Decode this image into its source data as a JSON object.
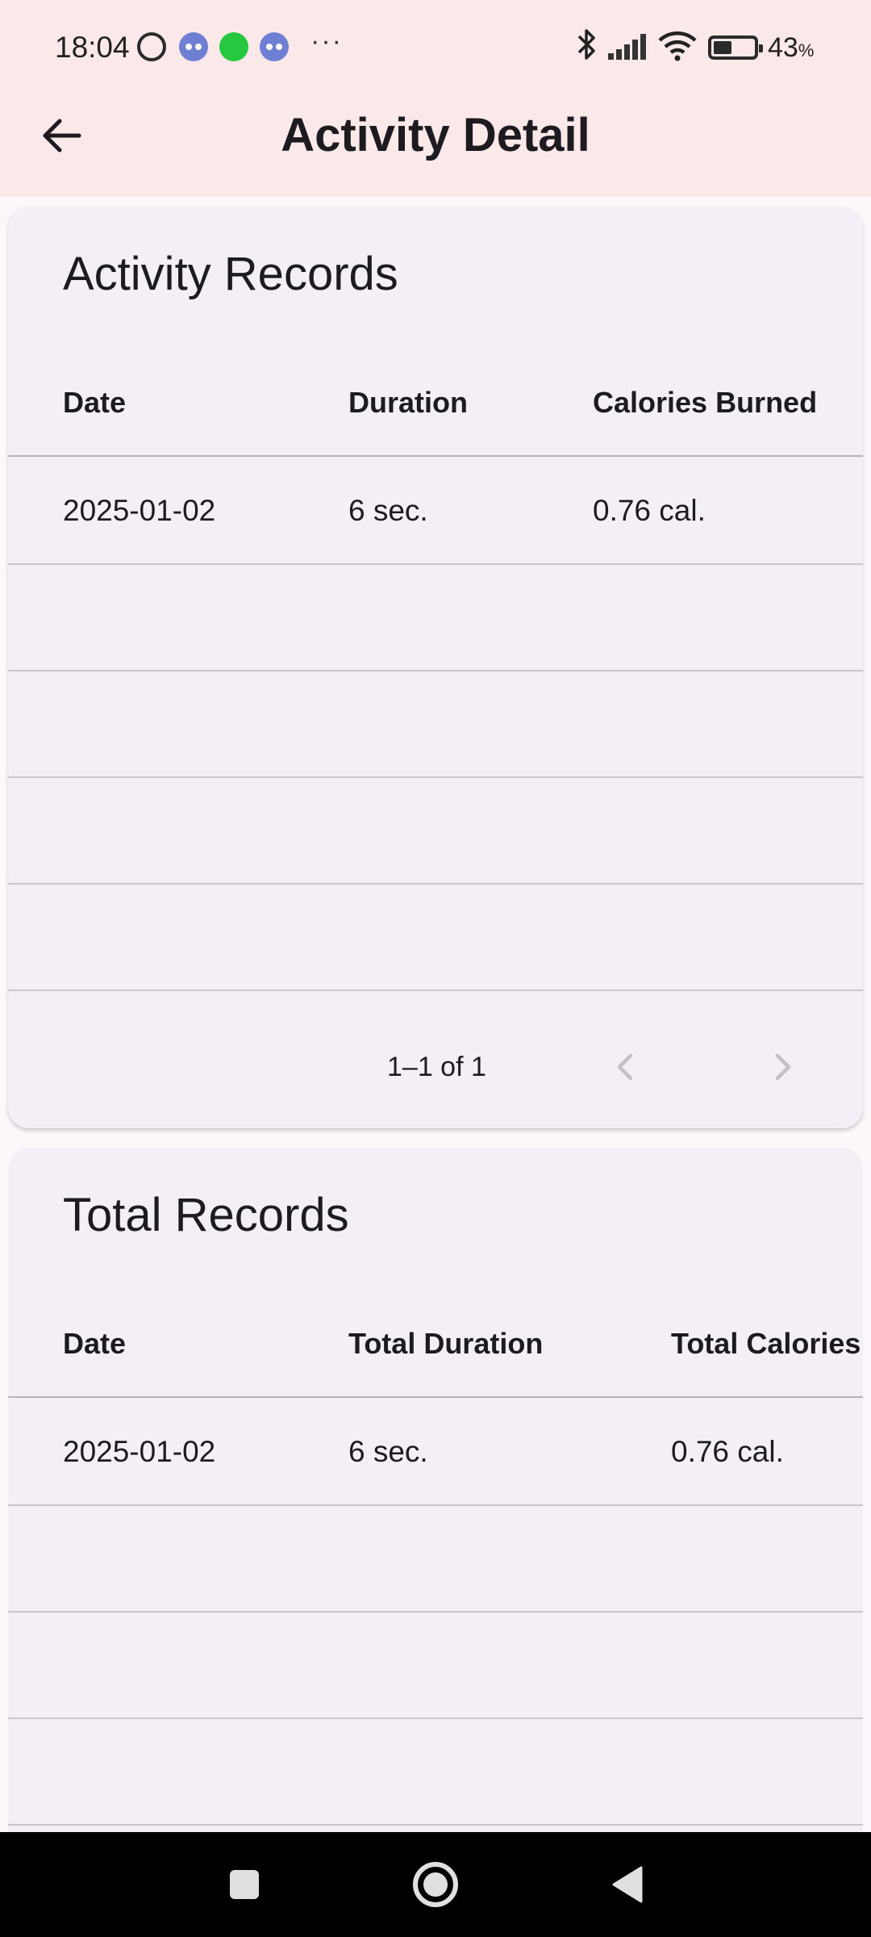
{
  "status_bar": {
    "time": "18:04",
    "more": "···",
    "battery_percent": "43",
    "battery_unit": "%",
    "battery_level": 0.43,
    "icons": [
      "alarm-icon",
      "discord-icon",
      "whatsapp-icon",
      "discord-icon",
      "bluetooth-icon",
      "signal-icon",
      "wifi-icon",
      "battery-icon"
    ]
  },
  "app_bar": {
    "title": "Activity Detail",
    "back_icon": "arrow-left-icon"
  },
  "activity_records": {
    "title": "Activity Records",
    "columns": [
      "Date",
      "Duration",
      "Calories Burned"
    ],
    "rows": [
      [
        "2025-01-02",
        "6 sec.",
        "0.76 cal."
      ]
    ],
    "pagination": {
      "label": "1–1 of 1",
      "prev_icon": "chevron-left-icon",
      "next_icon": "chevron-right-icon"
    }
  },
  "total_records": {
    "title": "Total Records",
    "columns": [
      "Date",
      "Total Duration",
      "Total Calories"
    ],
    "rows": [
      [
        "2025-01-02",
        "6 sec.",
        "0.76 cal."
      ]
    ]
  },
  "nav_bar": {
    "icons": [
      "recents-square-icon",
      "home-circle-icon",
      "back-triangle-icon"
    ]
  },
  "colors": {
    "app_bar_bg": "#fbe8e8",
    "card_bg": "#f4eff6",
    "divider": "#c9c5cb",
    "text": "#1d1b20"
  }
}
